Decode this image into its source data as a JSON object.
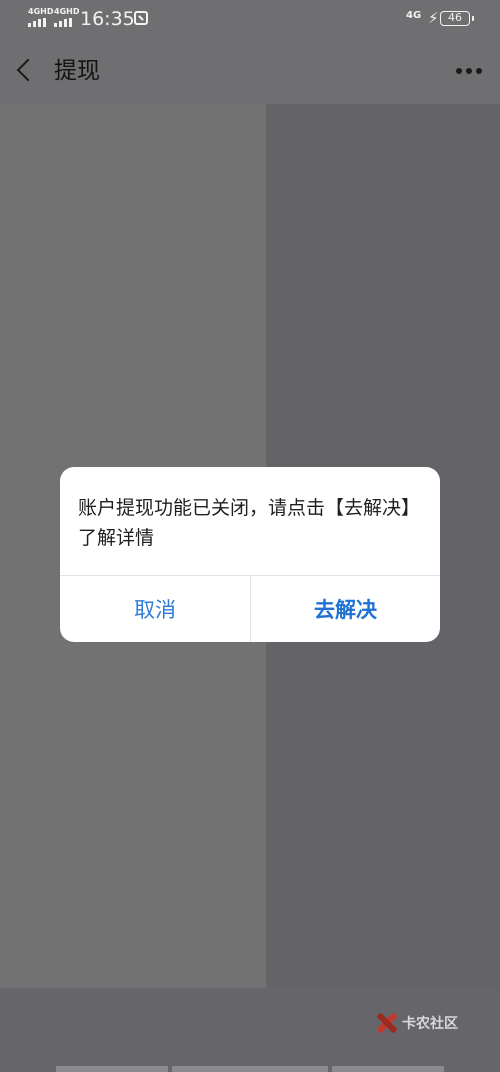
{
  "status_bar": {
    "sim1": "4GHD",
    "sim2": "4GHD",
    "time": "16:35",
    "network": "4G",
    "battery": "46"
  },
  "nav": {
    "title": "提现",
    "back_icon": "chevron-left-icon",
    "more_icon": "more-dots-icon"
  },
  "dialog": {
    "message": "账户提现功能已关闭，请点击【去解决】了解详情",
    "cancel_label": "取消",
    "confirm_label": "去解决"
  },
  "watermark": {
    "text": "卡农社区"
  },
  "colors": {
    "accent": "#2f7cd6",
    "overlay": "#6f6f72"
  }
}
